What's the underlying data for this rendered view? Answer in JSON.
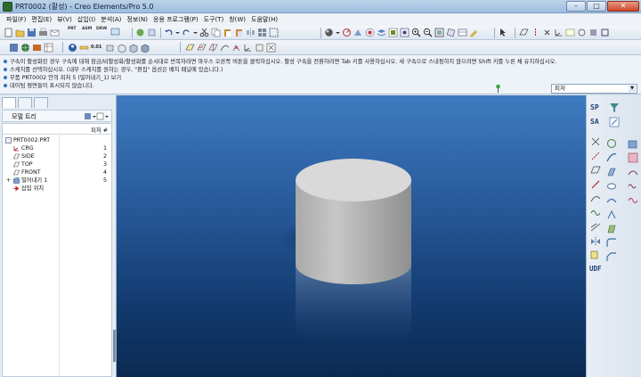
{
  "window": {
    "title": "PRT0002 (활성) - Creo Elements/Pro 5.0",
    "minimize_label": "–",
    "maximize_label": "□",
    "close_label": "✕"
  },
  "menu": [
    "파일(F)",
    "편집(E)",
    "뷰(V)",
    "삽입(I)",
    "분석(A)",
    "정보(N)",
    "응용 프로그램(P)",
    "도구(T)",
    "창(W)",
    "도움말(H)"
  ],
  "toolbar": {
    "prt_label": "PRT",
    "asm_label": "ASM",
    "drw_label": "DRW",
    "scale_label": "0.01"
  },
  "messages": [
    "구속이 활성화된 경우 구속에 대해 잠금/비활성화/활성화를 순서대로 반복하려면 마우스 오른쪽 버튼을 클릭하십시오. 활성 구속을 전환하려면 Tab 키를 사용하십시오. 새 구속으로 스내핑하지 않으려면 Shift 키를 누른 채 유지하십시오.",
    "스케치를 선택하십시오. (내부 스케치를 원하는 경우, \"편집\" 옵션은 배치 패널에 있습니다.)",
    "부품 PRT0002 안의 피처 5 (밀어내기_1) 보기",
    "데이텀 평면들이 표시되지 않습니다."
  ],
  "filter": {
    "value": "피처",
    "arrow": "▼"
  },
  "model_tree": {
    "title": "모델 트리",
    "column_header": "피처 #",
    "items": [
      {
        "label": "PRT0002.PRT",
        "num": "",
        "icon": "part-icon"
      },
      {
        "label": "CRG",
        "num": "1",
        "icon": "csys-icon"
      },
      {
        "label": "SIDE",
        "num": "2",
        "icon": "datum-plane-icon"
      },
      {
        "label": "TOP",
        "num": "3",
        "icon": "datum-plane-icon"
      },
      {
        "label": "FRONT",
        "num": "4",
        "icon": "datum-plane-icon"
      },
      {
        "label": "밀어내기 1",
        "num": "5",
        "icon": "extrude-icon"
      },
      {
        "label": "삽입 위치",
        "num": "",
        "icon": "insert-here-icon"
      }
    ],
    "expand_glyph": "+"
  },
  "right_toolbar": {
    "sp_label": "SP",
    "sa_label": "SA",
    "udf_label": "UDF"
  },
  "colors": {
    "viewport_top": "#3f7bc0",
    "viewport_bottom": "#0b2a52",
    "cylinder_side": "#b8b8b8",
    "cylinder_top": "#d9d9d9"
  }
}
